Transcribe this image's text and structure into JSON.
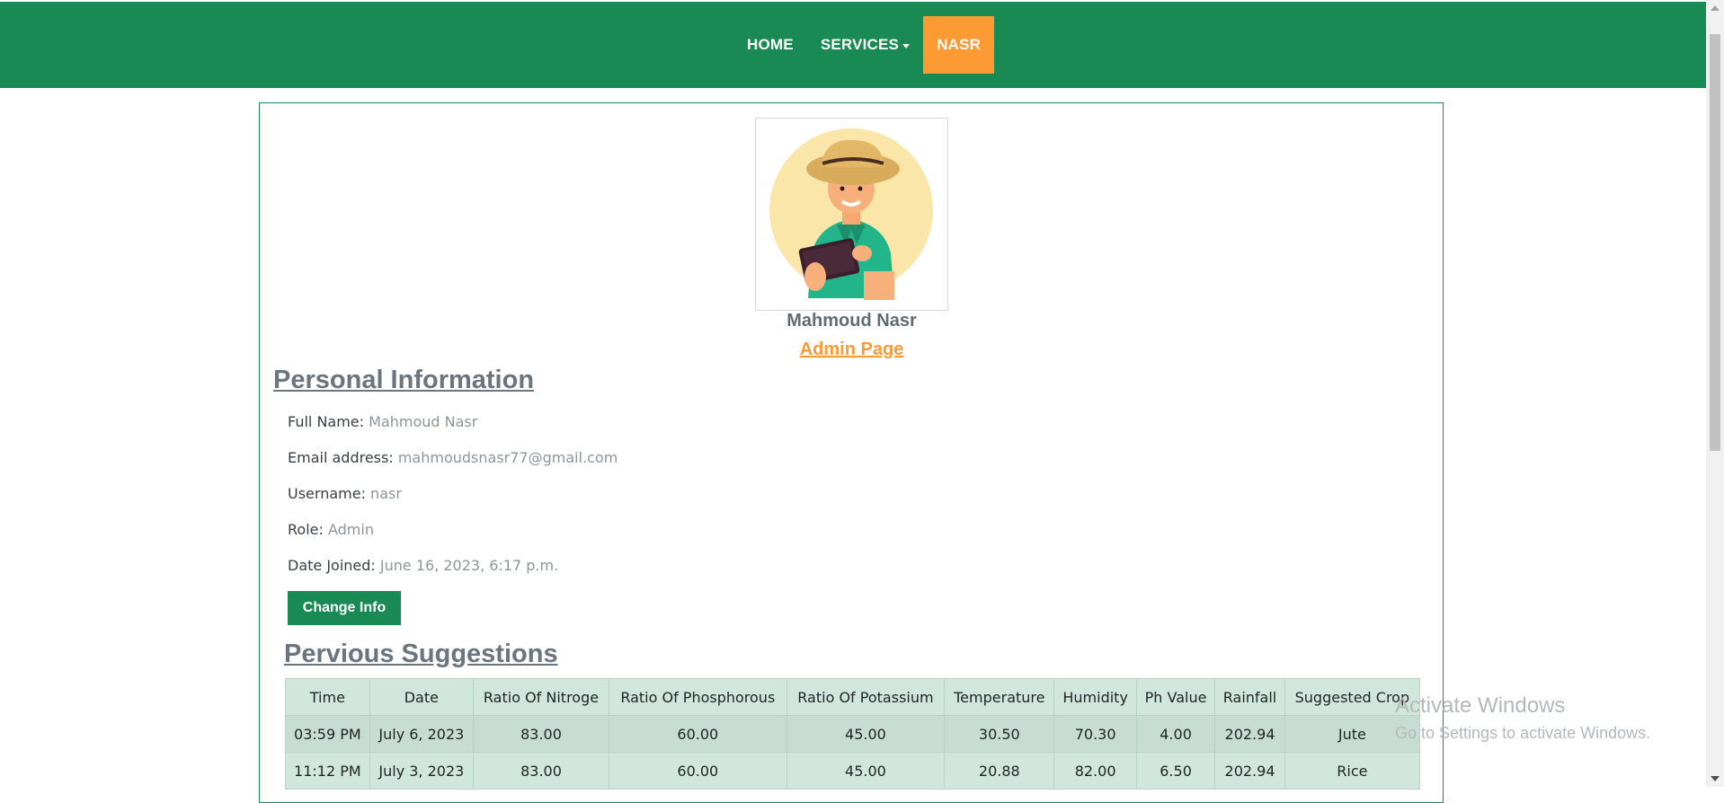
{
  "nav": {
    "home": "HOME",
    "services": "SERVICES",
    "user": "NASR"
  },
  "profile": {
    "name": "Mahmoud Nasr",
    "admin_link": "Admin Page"
  },
  "personal_info": {
    "title": "Personal Information",
    "rows": [
      {
        "label": "Full Name:",
        "value": "Mahmoud Nasr"
      },
      {
        "label": "Email address:",
        "value": "mahmoudsnasr77@gmail.com"
      },
      {
        "label": "Username:",
        "value": "nasr"
      },
      {
        "label": "Role:",
        "value": "Admin"
      },
      {
        "label": "Date Joined:",
        "value": "June 16, 2023, 6:17 p.m."
      }
    ],
    "change_button": "Change Info"
  },
  "suggestions": {
    "title": "Pervious Suggestions",
    "headers": [
      "Time",
      "Date",
      "Ratio Of Nitroge",
      "Ratio Of Phosphorous",
      "Ratio Of Potassium",
      "Temperature",
      "Humidity",
      "Ph Value",
      "Rainfall",
      "Suggested Crop"
    ],
    "rows": [
      [
        "03:59 PM",
        "July 6, 2023",
        "83.00",
        "60.00",
        "45.00",
        "30.50",
        "70.30",
        "4.00",
        "202.94",
        "Jute"
      ],
      [
        "11:12 PM",
        "July 3, 2023",
        "83.00",
        "60.00",
        "45.00",
        "20.88",
        "82.00",
        "6.50",
        "202.94",
        "Rice"
      ]
    ]
  },
  "watermark": {
    "line1": "Activate Windows",
    "line2": "Go to Settings to activate Windows."
  },
  "colors": {
    "brand_green": "#198a54",
    "accent_orange": "#fd9a33"
  }
}
